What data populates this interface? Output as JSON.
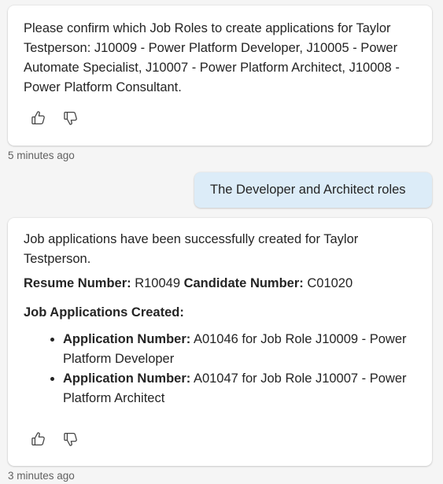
{
  "messages": {
    "bot1": {
      "text": "Please confirm which Job Roles to create applications for Taylor Testperson: J10009 - Power Platform Developer, J10005 - Power Automate Specialist, J10007 - Power Platform Architect, J10008 - Power Platform Consultant.",
      "timestamp": "5 minutes ago"
    },
    "user1": {
      "text": "The Developer and Architect roles"
    },
    "bot2": {
      "intro": "Job applications have been successfully created for Taylor Testperson.",
      "resume_label": "Resume Number:",
      "resume_value": " R10049 ",
      "candidate_label": "Candidate Number:",
      "candidate_value": " C01020",
      "apps_heading": "Job Applications Created:",
      "applications": [
        {
          "label": "Application Number:",
          "value": " A01046 for Job Role J10009 - Power Platform Developer"
        },
        {
          "label": "Application Number:",
          "value": " A01047 for Job Role J10007 - Power Platform Architect"
        }
      ],
      "timestamp": "3 minutes ago"
    }
  },
  "icons": {
    "thumbs_up": "thumbs-up-icon",
    "thumbs_down": "thumbs-down-icon"
  },
  "colors": {
    "user_bubble": "#dcecf8",
    "card_bg": "#ffffff",
    "page_bg": "#f5f5f5"
  }
}
